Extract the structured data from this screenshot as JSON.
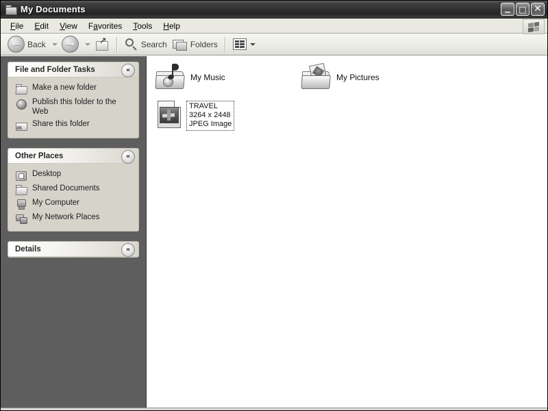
{
  "window": {
    "title": "My Documents",
    "title_icon": "folder-icon",
    "buttons": {
      "minimize": "_",
      "maximize": "□",
      "close": "✕"
    }
  },
  "menubar": {
    "items": [
      {
        "label": "File",
        "accel": "F"
      },
      {
        "label": "Edit",
        "accel": "E"
      },
      {
        "label": "View",
        "accel": "V"
      },
      {
        "label": "Favorites",
        "accel": "a"
      },
      {
        "label": "Tools",
        "accel": "T"
      },
      {
        "label": "Help",
        "accel": "H"
      }
    ],
    "logo": "windows-flag-icon"
  },
  "toolbar": {
    "back_label": "Back",
    "back_icon": "arrow-left-icon",
    "forward_icon": "arrow-right-icon",
    "up_icon": "folder-up-icon",
    "search_label": "Search",
    "search_icon": "magnifier-icon",
    "folders_label": "Folders",
    "folders_icon": "folders-icon",
    "views_icon": "views-grid-icon"
  },
  "sidebar": {
    "panels": [
      {
        "title": "File and Folder Tasks",
        "chevron": "«",
        "chevron_name": "collapse-chevron-icon",
        "collapsed": false,
        "items": [
          {
            "label": "Make a new folder",
            "icon": "new-folder-icon"
          },
          {
            "label": "Publish this folder to the Web",
            "icon": "publish-web-icon"
          },
          {
            "label": "Share this folder",
            "icon": "share-folder-icon"
          }
        ]
      },
      {
        "title": "Other Places",
        "chevron": "«",
        "chevron_name": "collapse-chevron-icon",
        "collapsed": false,
        "items": [
          {
            "label": "Desktop",
            "icon": "desktop-icon"
          },
          {
            "label": "Shared Documents",
            "icon": "shared-folder-icon"
          },
          {
            "label": "My Computer",
            "icon": "my-computer-icon"
          },
          {
            "label": "My Network Places",
            "icon": "network-places-icon"
          }
        ]
      },
      {
        "title": "Details",
        "chevron": "»",
        "chevron_name": "expand-chevron-icon",
        "collapsed": true,
        "items": []
      }
    ]
  },
  "content": {
    "items": [
      {
        "name": "My Music",
        "icon": "music-folder-icon",
        "type": "folder"
      },
      {
        "name": "My Pictures",
        "icon": "pictures-folder-icon",
        "type": "folder"
      },
      {
        "name": "TRAVEL",
        "icon": "jpeg-file-icon",
        "type": "file",
        "selected": true
      }
    ],
    "selected_detail": {
      "name": "TRAVEL",
      "dimensions": "3264 x 2448",
      "filetype": "JPEG Image"
    }
  },
  "colors": {
    "sidebar_bg": "#5e5e5e",
    "panel_bg": "#d6d3cb",
    "content_bg": "#ffffff",
    "titlebar": "#2e2e2e"
  }
}
